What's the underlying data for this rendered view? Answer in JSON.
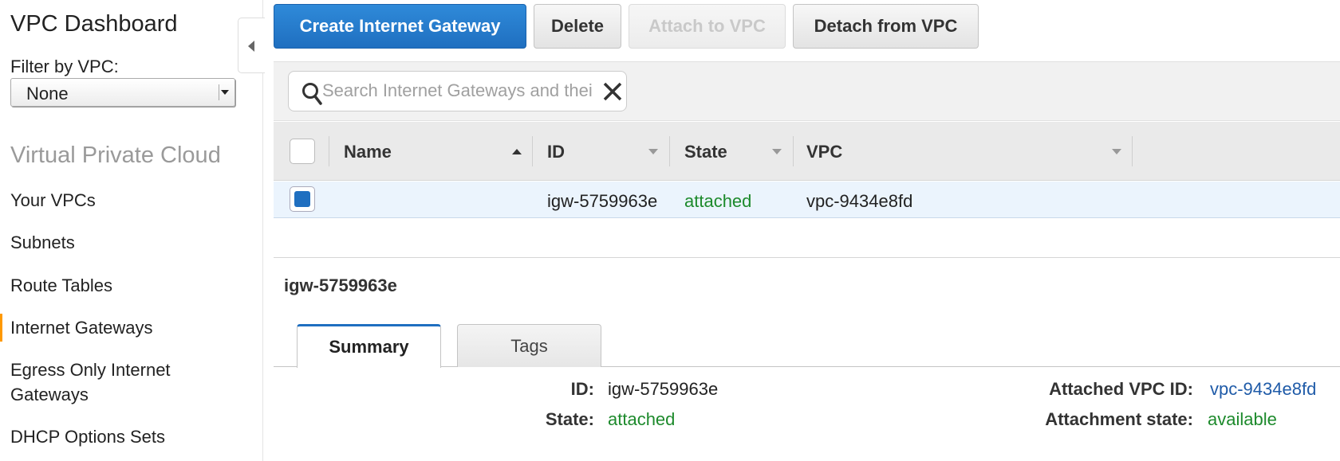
{
  "sidebar": {
    "title": "VPC Dashboard",
    "filter_label": "Filter by VPC:",
    "filter_value": "None",
    "section_title": "Virtual Private Cloud",
    "items": [
      {
        "label": "Your VPCs"
      },
      {
        "label": "Subnets"
      },
      {
        "label": "Route Tables"
      },
      {
        "label": "Internet Gateways"
      },
      {
        "label": "Egress Only Internet Gateways"
      },
      {
        "label": "DHCP Options Sets"
      }
    ],
    "active_item": "Internet Gateways"
  },
  "toolbar": {
    "create_label": "Create Internet Gateway",
    "delete_label": "Delete",
    "attach_label": "Attach to VPC",
    "detach_label": "Detach from VPC"
  },
  "search": {
    "placeholder": "Search Internet Gateways and their properties"
  },
  "table": {
    "columns": [
      "Name",
      "ID",
      "State",
      "VPC"
    ],
    "rows": [
      {
        "name": "",
        "id": "igw-5759963e",
        "state": "attached",
        "vpc": "vpc-9434e8fd",
        "selected": true
      }
    ]
  },
  "details": {
    "title": "igw-5759963e",
    "tabs": [
      "Summary",
      "Tags"
    ],
    "active_tab": "Summary",
    "id_label": "ID:",
    "id_value": "igw-5759963e",
    "state_label": "State:",
    "state_value": "attached",
    "vpc_label": "Attached VPC ID:",
    "vpc_value": "vpc-9434e8fd",
    "attach_state_label": "Attachment state:",
    "attach_state_value": "available"
  },
  "colors": {
    "primary": "#1f6fc0",
    "success": "#1d8a2c",
    "link": "#1f5ba8",
    "active_nav_indicator": "#ff9900"
  }
}
